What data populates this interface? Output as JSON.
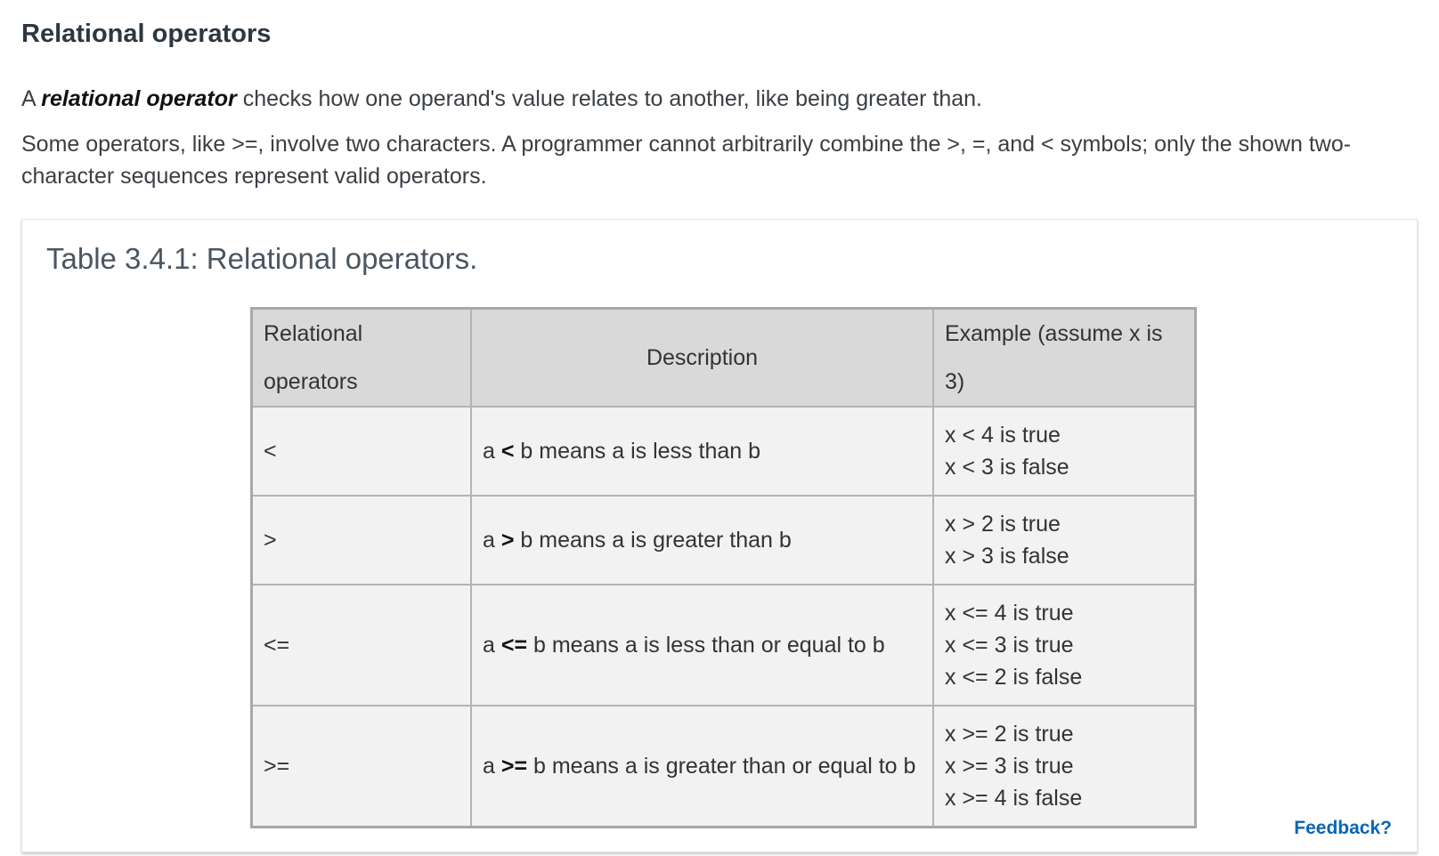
{
  "section": {
    "title": "Relational operators"
  },
  "intro": {
    "p1_prefix": "A ",
    "p1_term": "relational operator",
    "p1_suffix": " checks how one operand's value relates to another, like being greater than.",
    "p2": "Some operators, like >=, involve two characters. A programmer cannot arbitrarily combine the >, =, and < symbols; only the shown two-character sequences represent valid operators."
  },
  "table": {
    "caption": "Table 3.4.1: Relational operators.",
    "headers": [
      "Relational operators",
      "Description",
      "Example (assume x is 3)"
    ],
    "rows": [
      {
        "operator": "<",
        "desc_a": "a ",
        "desc_op": "<",
        "desc_rest": " b means a is less than b",
        "examples": [
          "x < 4 is true",
          "x < 3 is false"
        ]
      },
      {
        "operator": ">",
        "desc_a": "a ",
        "desc_op": ">",
        "desc_rest": " b means a is greater than b",
        "examples": [
          "x > 2 is true",
          "x > 3 is false"
        ]
      },
      {
        "operator": "<=",
        "desc_a": "a ",
        "desc_op": "<=",
        "desc_rest": " b means a is less than or equal to b",
        "examples": [
          "x <= 4 is true",
          "x <= 3 is true",
          "x <= 2 is false"
        ]
      },
      {
        "operator": ">=",
        "desc_a": "a ",
        "desc_op": ">=",
        "desc_rest": " b means a is greater than or equal to b",
        "examples": [
          "x >= 2 is true",
          "x >= 3 is true",
          "x >= 4 is false"
        ]
      }
    ]
  },
  "feedback": {
    "label": "Feedback?"
  },
  "colors": {
    "link": "#0a65b5",
    "header_bg": "#d9d9d9",
    "cell_bg": "#f2f2f2"
  }
}
